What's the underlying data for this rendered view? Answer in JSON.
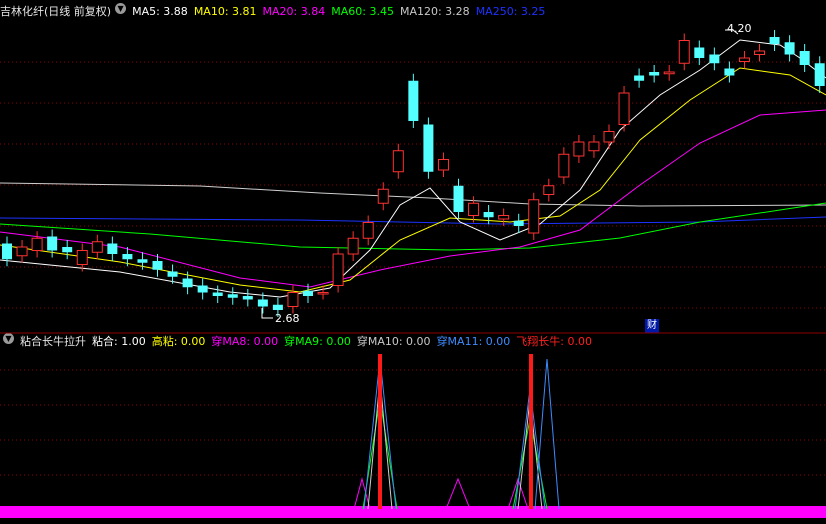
{
  "top_legend": {
    "title": "吉林化纤(日线 前复权)",
    "items": [
      {
        "label": "MA5: 3.88",
        "color": "#ffffff"
      },
      {
        "label": "MA10: 3.81",
        "color": "#ffff00"
      },
      {
        "label": "MA20: 3.84",
        "color": "#ff00ff"
      },
      {
        "label": "MA60: 3.45",
        "color": "#00ff00"
      },
      {
        "label": "MA120: 3.28",
        "color": "#c8c8c8"
      },
      {
        "label": "MA250: 3.25",
        "color": "#1e32ff"
      }
    ]
  },
  "price_labels": {
    "high": "4.20",
    "low": "2.68",
    "caiflag": "财"
  },
  "bottom_legend": {
    "title": "粘合长牛拉升",
    "items": [
      {
        "label": "粘合: 1.00",
        "color": "#ffffff"
      },
      {
        "label": "高粘: 0.00",
        "color": "#ffff00"
      },
      {
        "label": "穿MA8: 0.00",
        "color": "#ff00ff"
      },
      {
        "label": "穿MA9: 0.00",
        "color": "#00ff00"
      },
      {
        "label": "穿MA10: 0.00",
        "color": "#c8c8c8"
      },
      {
        "label": "穿MA11: 0.00",
        "color": "#3d8bff"
      },
      {
        "label": "飞翔长牛: 0.00",
        "color": "#ff2020"
      }
    ]
  },
  "chart_data": {
    "type": "candlestick",
    "y_high": 4.2,
    "y_low": 2.68,
    "candles": [
      {
        "o": 3.02,
        "c": 2.93
      },
      {
        "o": 2.95,
        "c": 3.0
      },
      {
        "o": 2.98,
        "c": 3.05
      },
      {
        "o": 3.06,
        "c": 2.98
      },
      {
        "o": 3.0,
        "c": 2.97
      },
      {
        "o": 2.9,
        "c": 2.98
      },
      {
        "o": 2.97,
        "c": 3.03
      },
      {
        "o": 3.02,
        "c": 2.96
      },
      {
        "o": 2.96,
        "c": 2.93
      },
      {
        "o": 2.93,
        "c": 2.91
      },
      {
        "o": 2.92,
        "c": 2.87
      },
      {
        "o": 2.86,
        "c": 2.83
      },
      {
        "o": 2.82,
        "c": 2.77
      },
      {
        "o": 2.78,
        "c": 2.74
      },
      {
        "o": 2.74,
        "c": 2.72
      },
      {
        "o": 2.73,
        "c": 2.71
      },
      {
        "o": 2.72,
        "c": 2.7
      },
      {
        "o": 2.7,
        "c": 2.66
      },
      {
        "o": 2.67,
        "c": 2.64
      },
      {
        "o": 2.66,
        "c": 2.74
      },
      {
        "o": 2.75,
        "c": 2.72
      },
      {
        "o": 2.74,
        "c": 2.74
      },
      {
        "o": 2.78,
        "c": 2.96
      },
      {
        "o": 2.96,
        "c": 3.05
      },
      {
        "o": 3.05,
        "c": 3.14
      },
      {
        "o": 3.25,
        "c": 3.33
      },
      {
        "o": 3.43,
        "c": 3.55
      },
      {
        "o": 3.95,
        "c": 3.72
      },
      {
        "o": 3.7,
        "c": 3.43
      },
      {
        "o": 3.44,
        "c": 3.5
      },
      {
        "o": 3.35,
        "c": 3.2
      },
      {
        "o": 3.18,
        "c": 3.25
      },
      {
        "o": 3.2,
        "c": 3.17
      },
      {
        "o": 3.16,
        "c": 3.18
      },
      {
        "o": 3.15,
        "c": 3.12
      },
      {
        "o": 3.08,
        "c": 3.27
      },
      {
        "o": 3.3,
        "c": 3.35
      },
      {
        "o": 3.4,
        "c": 3.53
      },
      {
        "o": 3.52,
        "c": 3.6
      },
      {
        "o": 3.55,
        "c": 3.6
      },
      {
        "o": 3.6,
        "c": 3.66
      },
      {
        "o": 3.7,
        "c": 3.88
      },
      {
        "o": 3.98,
        "c": 3.95
      },
      {
        "o": 4.0,
        "c": 3.98
      },
      {
        "o": 3.99,
        "c": 4.0
      },
      {
        "o": 4.05,
        "c": 4.18
      },
      {
        "o": 4.14,
        "c": 4.08
      },
      {
        "o": 4.1,
        "c": 4.05
      },
      {
        "o": 4.02,
        "c": 3.98
      },
      {
        "o": 4.06,
        "c": 4.08
      },
      {
        "o": 4.1,
        "c": 4.12
      },
      {
        "o": 4.2,
        "c": 4.16
      },
      {
        "o": 4.17,
        "c": 4.1
      },
      {
        "o": 4.12,
        "c": 4.04
      },
      {
        "o": 4.05,
        "c": 3.92
      },
      {
        "o": 3.9,
        "c": 3.76
      },
      {
        "o": 3.75,
        "c": 3.62
      }
    ]
  }
}
